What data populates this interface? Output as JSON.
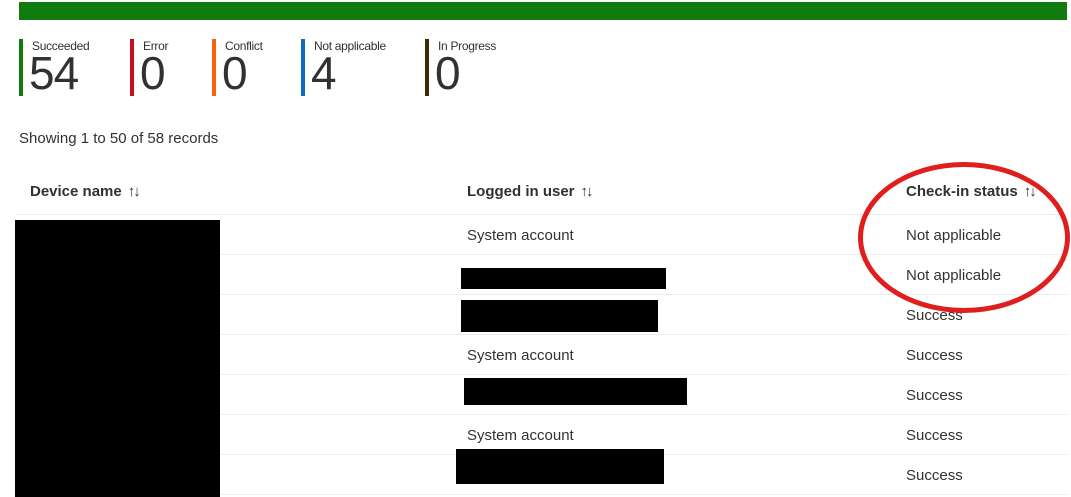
{
  "progress": {
    "fraction": 1.0,
    "color": "#107c10"
  },
  "stats": [
    {
      "label": "Succeeded",
      "value": "54",
      "color": "#107c10"
    },
    {
      "label": "Error",
      "value": "0",
      "color": "#c50f1f"
    },
    {
      "label": "Conflict",
      "value": "0",
      "color": "#f7630c"
    },
    {
      "label": "Not applicable",
      "value": "4",
      "color": "#0f6cbd"
    },
    {
      "label": "In Progress",
      "value": "0",
      "color": "#3b2a0a"
    }
  ],
  "records_text": "Showing 1 to 50 of 58 records",
  "columns": {
    "device_name": "Device name",
    "logged_in_user": "Logged in user",
    "check_in_status": "Check-in status",
    "sort_icon": "↑↓"
  },
  "rows": [
    {
      "user": "System account",
      "status": "Not applicable"
    },
    {
      "user": "",
      "status": "Not applicable"
    },
    {
      "user": "",
      "status": "Success"
    },
    {
      "user": "System account",
      "status": "Success"
    },
    {
      "user": "",
      "status": "Success"
    },
    {
      "user": "System account",
      "status": "Success"
    },
    {
      "user": "",
      "status": "Success"
    }
  ],
  "annotation_color": "#e01e1e"
}
